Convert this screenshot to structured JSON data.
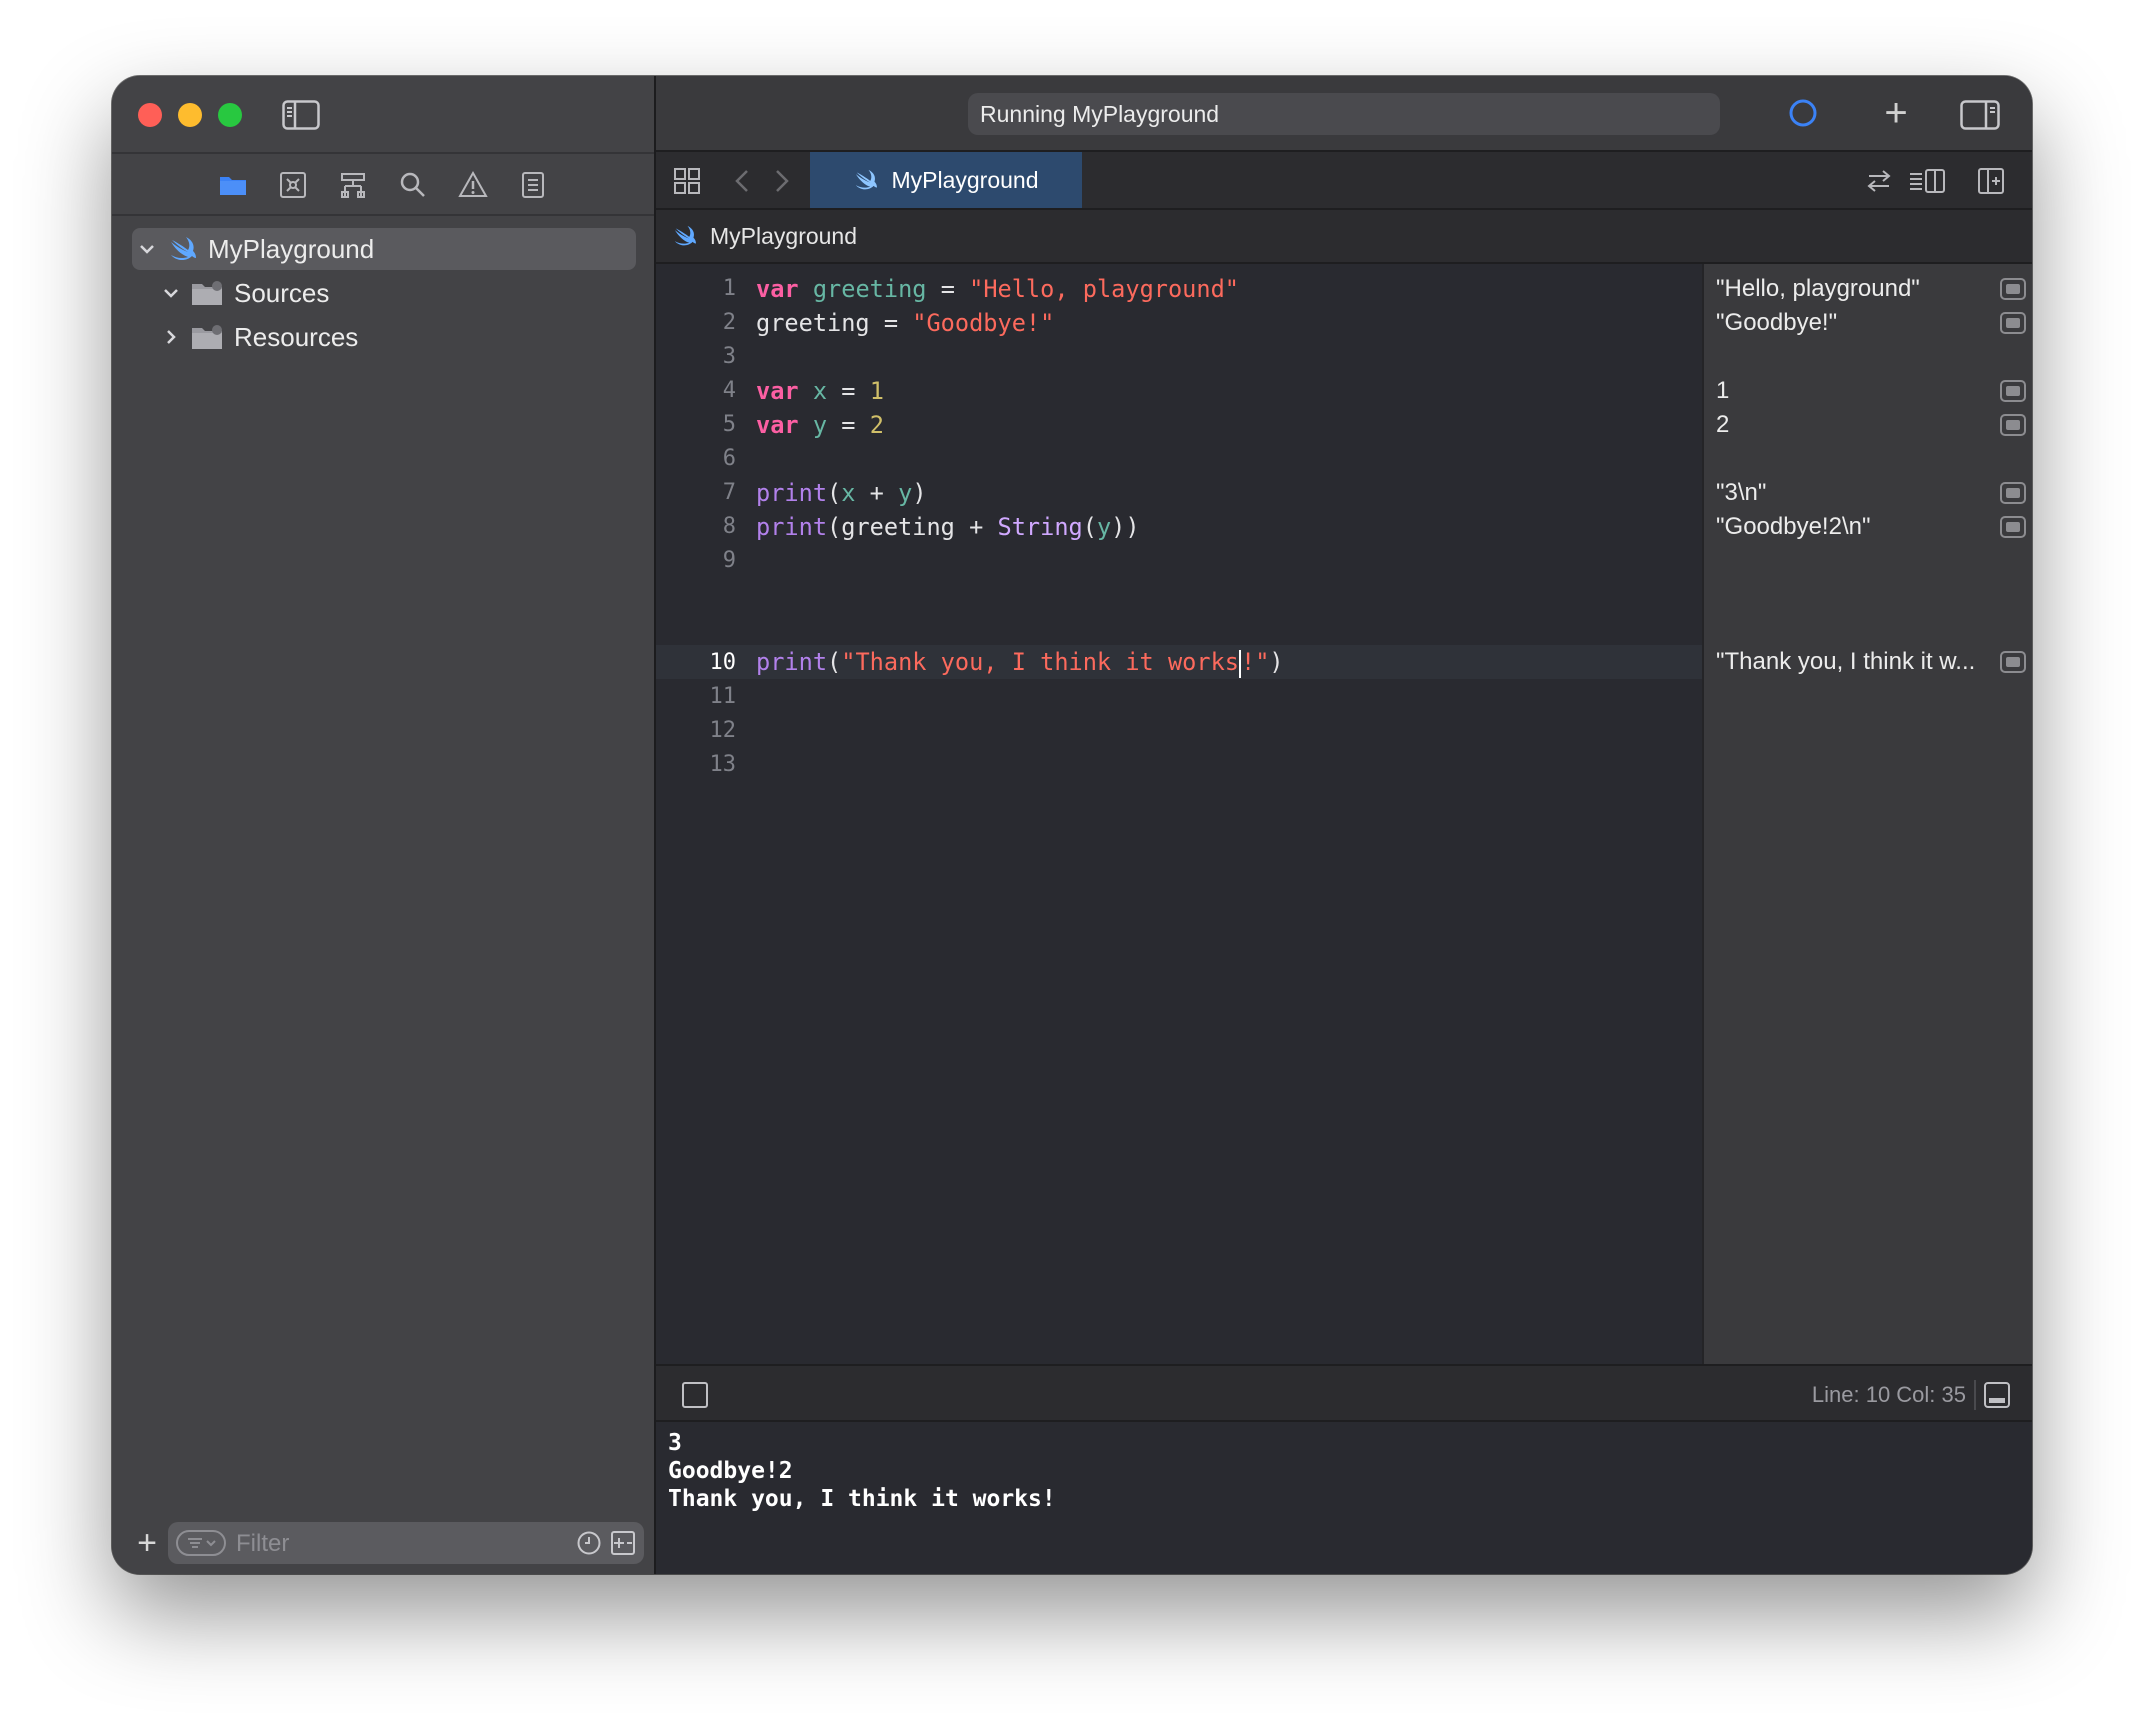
{
  "window": {
    "activity_status": "Running MyPlayground"
  },
  "colors": {
    "accent": "#3b82f6",
    "tab_background": "#2d4a6e",
    "keyword": "#fc5fa3",
    "string": "#fc6a5d",
    "number": "#d0bf69",
    "identifier": "#67b7a4",
    "function": "#b281eb"
  },
  "navigator": {
    "icons": [
      "folder-icon",
      "source-control-icon",
      "symbol-icon",
      "find-icon",
      "issue-icon",
      "report-icon"
    ],
    "tree": [
      {
        "label": "MyPlayground",
        "expanded": true,
        "icon": "swift-icon"
      },
      {
        "label": "Sources",
        "expanded": true,
        "icon": "folder-icon"
      },
      {
        "label": "Resources",
        "expanded": false,
        "icon": "folder-icon"
      }
    ],
    "filter_placeholder": "Filter"
  },
  "editor": {
    "tab_label": "MyPlayground",
    "breadcrumb": "MyPlayground",
    "line_numbers": [
      "1",
      "2",
      "3",
      "4",
      "5",
      "6",
      "7",
      "8",
      "9",
      "10",
      "11",
      "12",
      "13"
    ],
    "current_line": 10,
    "code": [
      "var greeting = \"Hello, playground\"",
      "greeting = \"Goodbye!\"",
      "",
      "var x = 1",
      "var y = 2",
      "",
      "print(x + y)",
      "print(greeting + String(y))",
      "",
      "print(\"Thank you, I think it works!\")",
      "",
      "",
      ""
    ]
  },
  "results": [
    {
      "line": 1,
      "text": "\"Hello, playground\""
    },
    {
      "line": 2,
      "text": "\"Goodbye!\""
    },
    {
      "line": 4,
      "text": "1"
    },
    {
      "line": 5,
      "text": "2"
    },
    {
      "line": 7,
      "text": "\"3\\n\""
    },
    {
      "line": 8,
      "text": "\"Goodbye!2\\n\""
    },
    {
      "line": 10,
      "text": "\"Thank you, I think it w..."
    }
  ],
  "status": {
    "line_col": "Line: 10  Col: 35"
  },
  "console": {
    "lines": [
      "3",
      "Goodbye!2",
      "Thank you, I think it works!"
    ]
  }
}
